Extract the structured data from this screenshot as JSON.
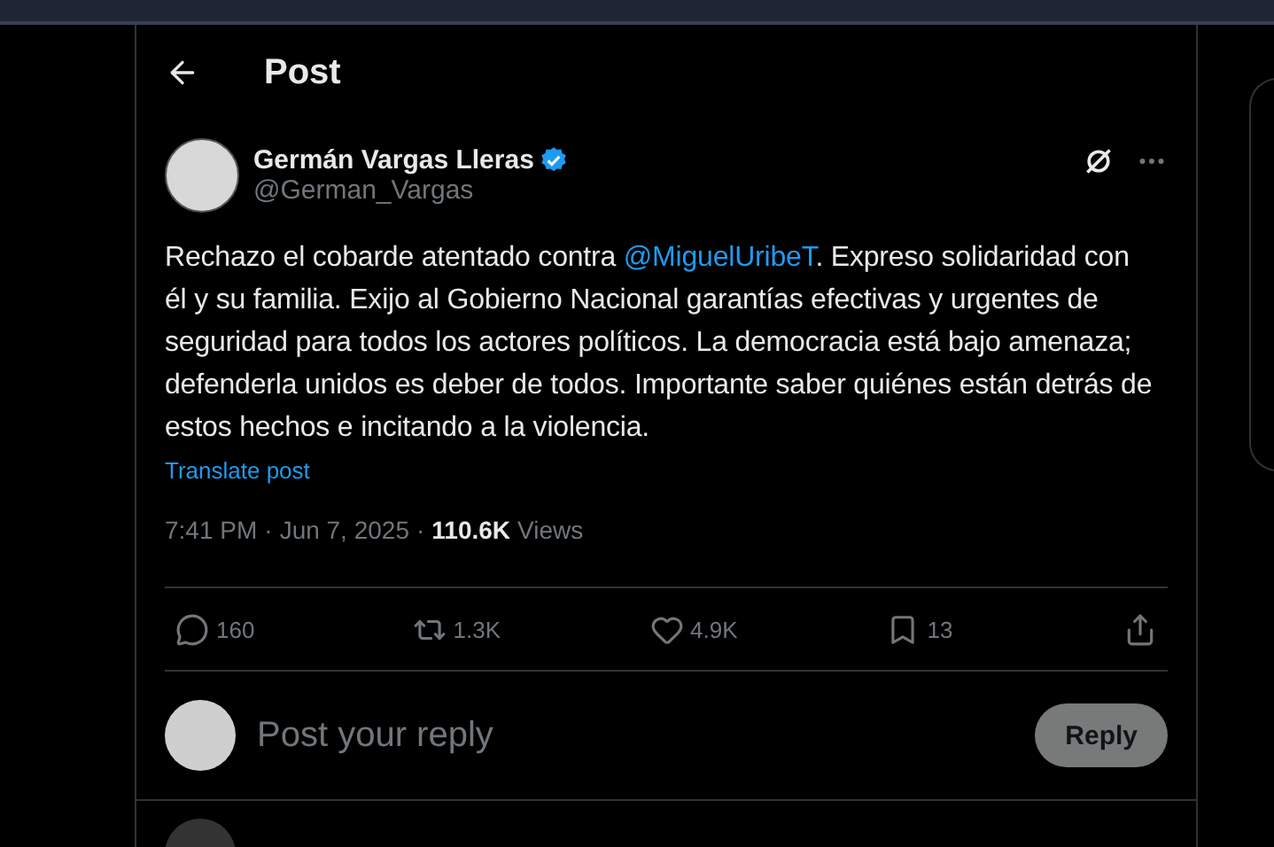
{
  "header": {
    "title": "Post"
  },
  "author": {
    "name": "Germán Vargas Lleras",
    "verified": true,
    "handle": "@German_Vargas"
  },
  "post": {
    "text_before": "Rechazo el cobarde atentado contra ",
    "mention": "@MiguelUribeT",
    "text_after": ". Expreso solidaridad con él y su familia. Exijo al Gobierno Nacional garantías efectivas y urgentes de seguridad para todos los actores políticos. La democracia está bajo amenaza; defenderla unidos es deber de todos. Importante saber quiénes están detrás de estos hechos e incitando a la violencia.",
    "translate": "Translate post"
  },
  "meta": {
    "separator": "·",
    "time": "7:41 PM",
    "date": "Jun 7, 2025",
    "views_count": "110.6K",
    "views_label": "Views"
  },
  "actions": [
    {
      "kind": "reply",
      "count": "160"
    },
    {
      "kind": "repost",
      "count": "1.3K"
    },
    {
      "kind": "like",
      "count": "4.9K"
    },
    {
      "kind": "bookmark",
      "count": "13"
    },
    {
      "kind": "share"
    }
  ],
  "composer": {
    "placeholder": "Post your reply",
    "button": "Reply",
    "disabled": true
  }
}
